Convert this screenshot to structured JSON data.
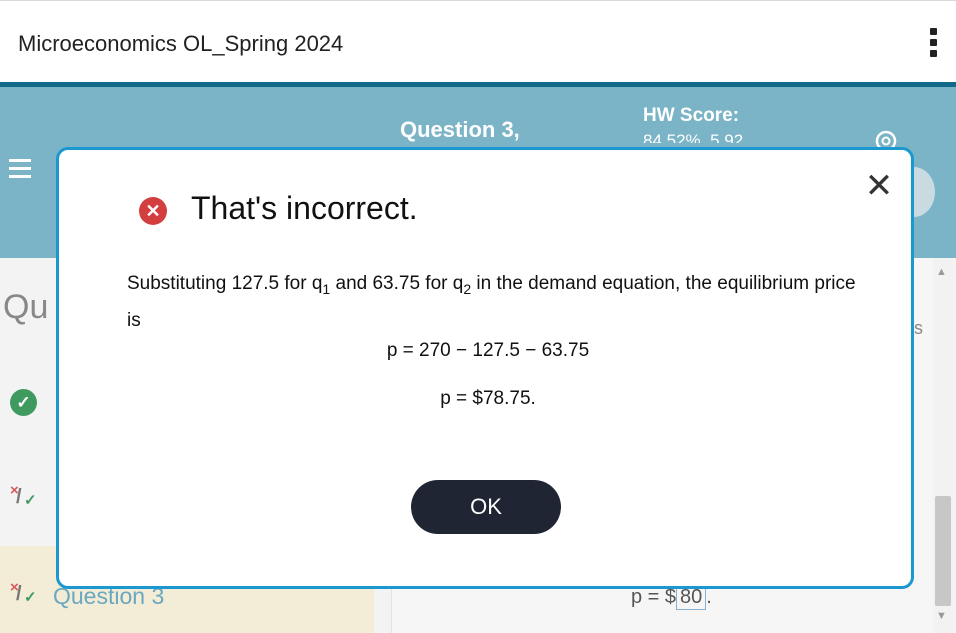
{
  "header": {
    "course_title": "Microeconomics OL_Spring 2024"
  },
  "assignment_bar": {
    "question_label": "Question 3,",
    "hw_score_label": "HW Score:",
    "hw_score_value": "84.52%, 5.92"
  },
  "sidebar": {
    "title_partial": "Qu",
    "current_question": "Question 3"
  },
  "main": {
    "answer_prefix": "p = $",
    "answer_value": "80",
    "answer_suffix": ".",
    "right_partial": "s"
  },
  "modal": {
    "title": "That's incorrect.",
    "body_part1": "Substituting 127.5 for q",
    "sub1": "1",
    "body_part2": " and 63.75 for q",
    "sub2": "2",
    "body_part3": " in the demand equation, the equilibrium price is",
    "equation1": "p = 270 − 127.5 − 63.75",
    "equation2": "p = $78.75.",
    "ok_label": "OK",
    "close_symbol": "✕"
  },
  "colors": {
    "accent_teal": "#7ab4c6",
    "modal_border": "#1b98cf",
    "error_red": "#d33f3f",
    "ok_button": "#1f2533"
  },
  "icons": [
    "kebab-menu-icon",
    "hamburger-icon",
    "gear-icon",
    "error-icon",
    "close-icon",
    "check-icon",
    "partial-credit-icon"
  ]
}
